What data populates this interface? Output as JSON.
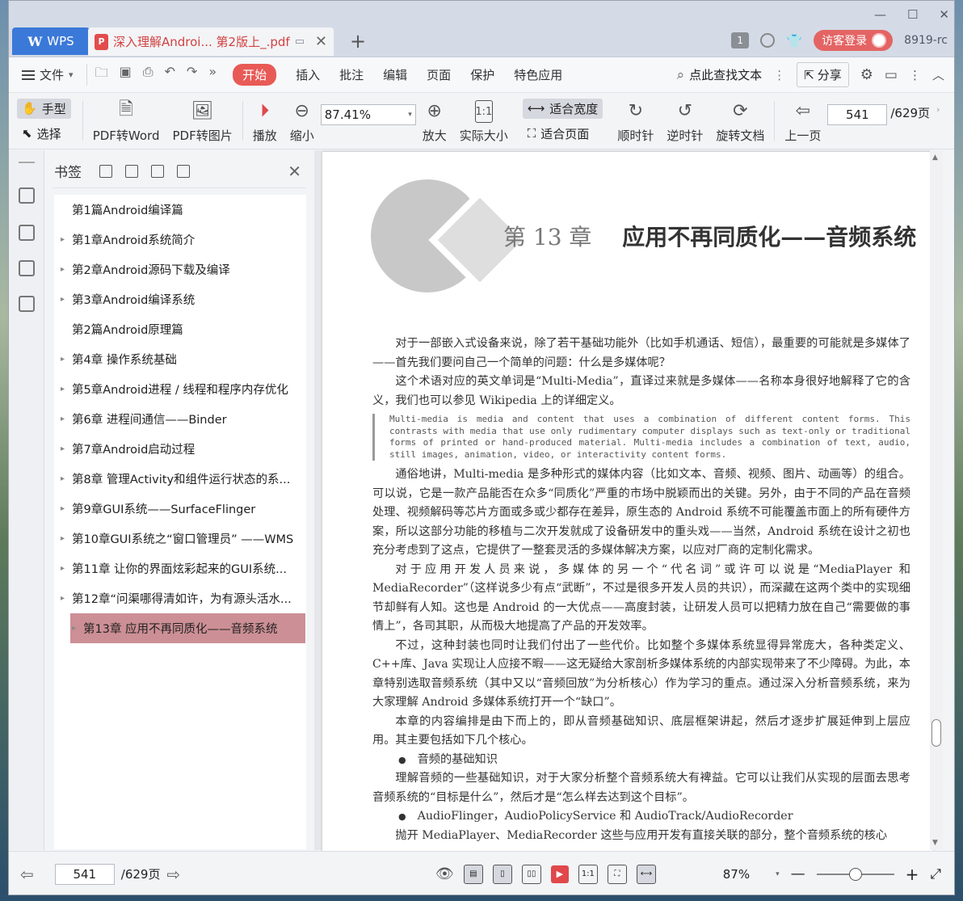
{
  "titlebar": {
    "app_tab": "WPS",
    "app_logo": "W",
    "doc_tab_title": "深入理解Androi... 第2版上_.pdf",
    "badge_num": "1",
    "login_label": "访客登录",
    "user_id": "8919-rc"
  },
  "menubar": {
    "file_label": "文件",
    "items": [
      "开始",
      "插入",
      "批注",
      "编辑",
      "页面",
      "保护",
      "特色应用"
    ],
    "active_index": 0,
    "search_label": "点此查找文本",
    "share_label": "分享"
  },
  "toolbar": {
    "hand_label": "手型",
    "select_label": "选择",
    "pdf_to_word": "PDF转Word",
    "pdf_to_image": "PDF转图片",
    "play": "播放",
    "zoom_out": "缩小",
    "zoom_value": "87.41%",
    "zoom_in": "放大",
    "actual_size": "实际大小",
    "fit_width": "适合宽度",
    "fit_page": "适合页面",
    "clockwise": "顺时针",
    "counterclockwise": "逆时针",
    "rotate_doc": "旋转文档",
    "prev_page": "上一页",
    "current_page": "541",
    "total_pages": "/629页"
  },
  "bookmarks": {
    "title": "书签",
    "items": [
      {
        "label": "第1篇Android编译篇",
        "expandable": false
      },
      {
        "label": "第1章Android系统简介",
        "expandable": true
      },
      {
        "label": "第2章Android源码下载及编译",
        "expandable": true
      },
      {
        "label": "第3章Android编译系统",
        "expandable": true
      },
      {
        "label": "第2篇Android原理篇",
        "expandable": false
      },
      {
        "label": "第4章  操作系统基础",
        "expandable": true
      },
      {
        "label": "第5章Android进程 / 线程和程序内存优化",
        "expandable": true
      },
      {
        "label": "第6章  进程间通信——Binder",
        "expandable": true
      },
      {
        "label": "第7章Android启动过程",
        "expandable": true
      },
      {
        "label": "第8章  管理Activity和组件运行状态的系...",
        "expandable": true
      },
      {
        "label": "第9章GUI系统——SurfaceFlinger",
        "expandable": true
      },
      {
        "label": "第10章GUI系统之“窗口管理员” ——WMS",
        "expandable": true
      },
      {
        "label": "第11章  让你的界面炫彩起来的GUI系统...",
        "expandable": true
      },
      {
        "label": "第12章“问渠哪得清如许，为有源头活水...",
        "expandable": true
      },
      {
        "label": "第13章  应用不再同质化——音频系统",
        "expandable": true
      }
    ],
    "selected_index": 14
  },
  "document": {
    "chapter_num": "第 13 章",
    "chapter_title": "应用不再同质化——音频系统",
    "p1": "对于一部嵌入式设备来说，除了若干基础功能外（比如手机通话、短信），最重要的可能就是多媒体了——首先我们要问自己一个简单的问题：什么是多媒体呢？",
    "p2": "这个术语对应的英文单词是“Multi-Media”，直译过来就是多媒体——名称本身很好地解释了它的含义，我们也可以参见 Wikipedia 上的详细定义。",
    "quote": "Multi-media is media and content that uses a combination of different content forms. This contrasts with media that use only rudimentary computer displays such as text-only or traditional forms of printed or hand-produced material. Multi-media includes a combination of text, audio, still images, animation, video, or interactivity content forms.",
    "p3": "通俗地讲，Multi-media 是多种形式的媒体内容（比如文本、音频、视频、图片、动画等）的组合。可以说，它是一款产品能否在众多“同质化”严重的市场中脱颖而出的关键。另外，由于不同的产品在音频处理、视频解码等芯片方面或多或少都存在差异，原生态的 Android 系统不可能覆盖市面上的所有硬件方案，所以这部分功能的移植与二次开发就成了设备研发中的重头戏——当然，Android 系统在设计之初也充分考虑到了这点，它提供了一整套灵活的多媒体解决方案，以应对厂商的定制化需求。",
    "p4": "对于应用开发人员来说，多媒体的另一个“代名词”或许可以说是“MediaPlayer 和 MediaRecorder”（这样说多少有点“武断”，不过是很多开发人员的共识），而深藏在这两个类中的实现细节却鲜有人知。这也是 Android 的一大优点——高度封装，让研发人员可以把精力放在自己“需要做的事情上”，各司其职，从而极大地提高了产品的开发效率。",
    "p5": "不过，这种封装也同时让我们付出了一些代价。比如整个多媒体系统显得异常庞大，各种类定义、C++库、Java 实现让人应接不暇——这无疑给大家剖析多媒体系统的内部实现带来了不少障碍。为此，本章特别选取音频系统（其中又以“音频回放”为分析核心）作为学习的重点。通过深入分析音频系统，来为大家理解 Android 多媒体系统打开一个“缺口”。",
    "p6": "本章的内容编排是由下而上的，即从音频基础知识、底层框架讲起，然后才逐步扩展延伸到上层应用。其主要包括如下几个核心。",
    "b1": "音频的基础知识",
    "p7": "理解音频的一些基础知识，对于大家分析整个音频系统大有裨益。它可以让我们从实现的层面去思考音频系统的“目标是什么”，然后才是“怎么样去达到这个目标”。",
    "b2": "AudioFlinger，AudioPolicyService 和 AudioTrack/AudioRecorder",
    "p8": "抛开 MediaPlayer、MediaRecorder 这些与应用开发有直接关联的部分，整个音频系统的核心"
  },
  "statusbar": {
    "current_page": "541",
    "total_pages": "/629页",
    "zoom_pct": "87%"
  },
  "colors": {
    "accent_red": "#e85a56",
    "wps_blue": "#3b79d9",
    "bookmark_selected": "#cc8f95"
  }
}
